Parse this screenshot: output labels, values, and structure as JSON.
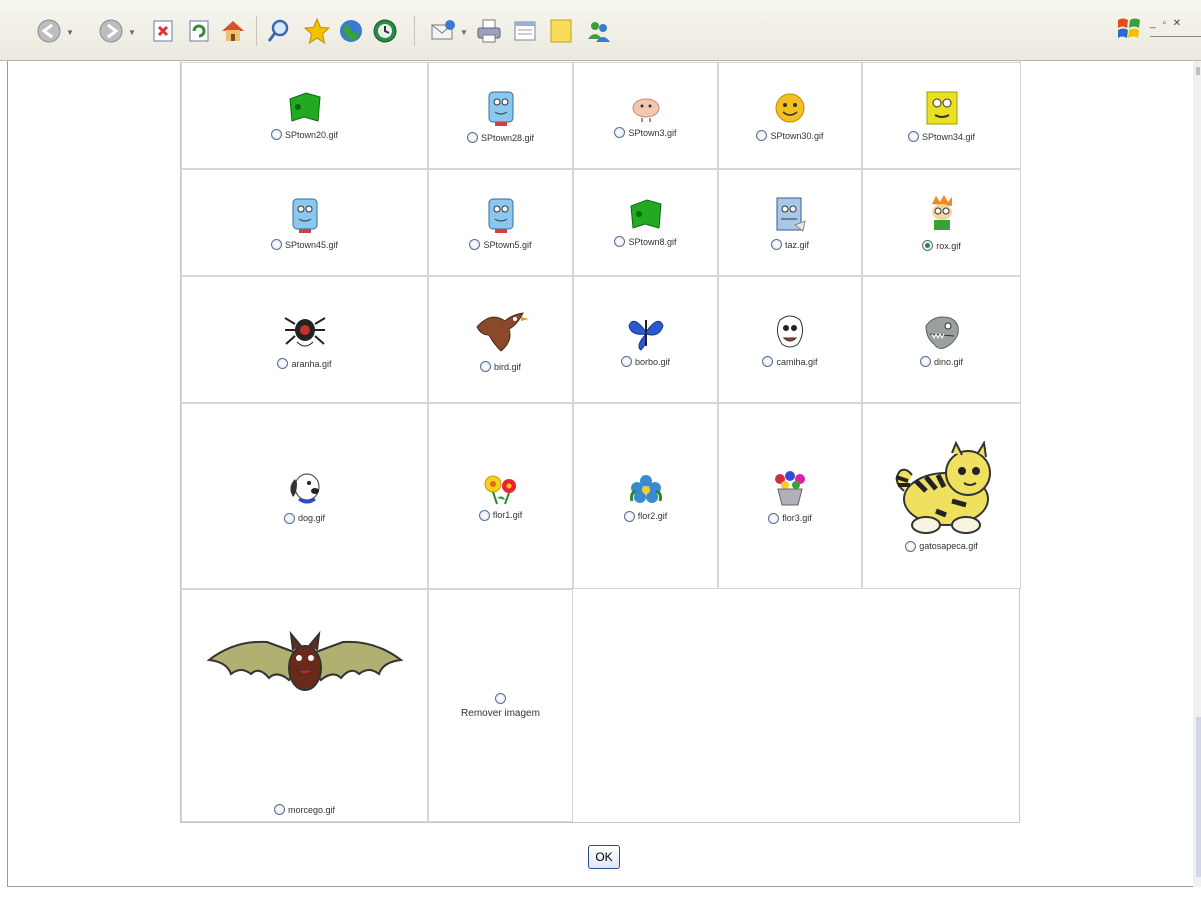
{
  "toolbar": {
    "buttons": [
      {
        "name": "back-icon",
        "color": "#7a7a7a"
      },
      {
        "name": "forward-icon",
        "color": "#7a7a7a"
      },
      {
        "name": "stop-icon",
        "color": "#d33"
      },
      {
        "name": "refresh-icon",
        "color": "#3a8a3a"
      },
      {
        "name": "home-icon",
        "color": "#e08a2a"
      },
      {
        "name": "search-icon",
        "color": "#3a6ab0"
      },
      {
        "name": "favorites-icon",
        "color": "#f2c200"
      },
      {
        "name": "media-icon",
        "color": "#2a7a2a"
      },
      {
        "name": "history-icon",
        "color": "#2a6a2a"
      },
      {
        "name": "mail-icon",
        "color": "#8a8a8a"
      },
      {
        "name": "print-icon",
        "color": "#6a6a9a"
      },
      {
        "name": "edit-icon",
        "color": "#6a8aaa"
      },
      {
        "name": "discuss-icon",
        "color": "#f0d060"
      },
      {
        "name": "messenger-icon",
        "color": "#3a7ad0"
      }
    ]
  },
  "images": {
    "rows": [
      [
        {
          "file": "SPtown20.gif",
          "icon": "green-flag-icon",
          "checked": false
        },
        {
          "file": "SPtown28.gif",
          "icon": "cartoon-character-icon",
          "checked": false
        },
        {
          "file": "SPtown3.gif",
          "icon": "pig-icon",
          "checked": false
        },
        {
          "file": "SPtown30.gif",
          "icon": "smiley-face-icon",
          "checked": false
        },
        {
          "file": "SPtown34.gif",
          "icon": "yellow-face-icon",
          "checked": false
        }
      ],
      [
        {
          "file": "SPtown45.gif",
          "icon": "cartoon-character-icon",
          "checked": false
        },
        {
          "file": "SPtown5.gif",
          "icon": "cartoon-character-icon",
          "checked": false
        },
        {
          "file": "SPtown8.gif",
          "icon": "green-flag-icon",
          "checked": false
        },
        {
          "file": "taz.gif",
          "icon": "taz-icon",
          "checked": false
        },
        {
          "file": "rox.gif",
          "icon": "rox-character-icon",
          "checked": true
        }
      ],
      [
        {
          "file": "aranha.gif",
          "icon": "spider-icon",
          "checked": false
        },
        {
          "file": "bird.gif",
          "icon": "bird-icon",
          "checked": false
        },
        {
          "file": "borbo.gif",
          "icon": "butterfly-icon",
          "checked": false
        },
        {
          "file": "camiha.gif",
          "icon": "cartoon-face-icon",
          "checked": false
        },
        {
          "file": "dino.gif",
          "icon": "dinosaur-icon",
          "checked": false
        }
      ],
      [
        {
          "file": "dog.gif",
          "icon": "dog-icon",
          "checked": false
        },
        {
          "file": "flor1.gif",
          "icon": "flower-icon",
          "checked": false
        },
        {
          "file": "flor2.gif",
          "icon": "blue-flower-icon",
          "checked": false
        },
        {
          "file": "flor3.gif",
          "icon": "flower-pot-icon",
          "checked": false
        },
        {
          "file": "gatosapeca.gif",
          "icon": "tiger-cat-icon",
          "checked": false
        }
      ]
    ],
    "last_row": {
      "bat": {
        "file": "morcego.gif",
        "icon": "bat-icon",
        "checked": false
      },
      "remove": {
        "label": "Remover imagem",
        "checked": false
      }
    }
  },
  "ok_label": "OK"
}
